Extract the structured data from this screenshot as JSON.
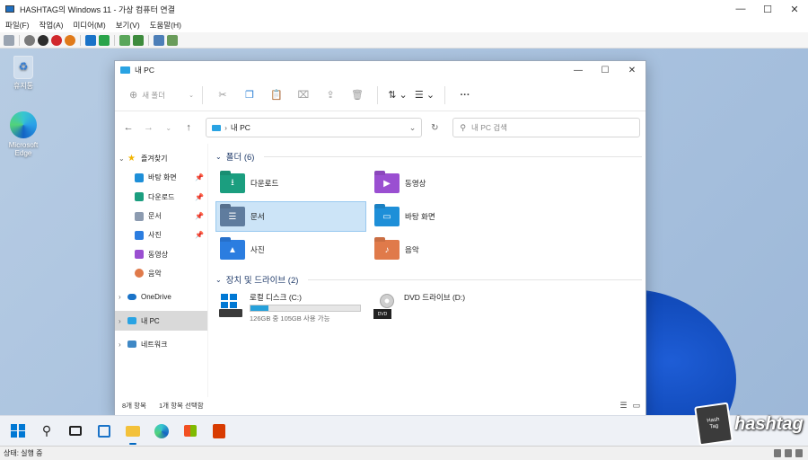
{
  "host": {
    "title": "HASHTAG의 Windows 11 - 가상 컴퓨터 연결",
    "menu": [
      "파일(F)",
      "작업(A)",
      "미디어(M)",
      "보기(V)",
      "도움말(H)"
    ],
    "status": "상태: 실행 중"
  },
  "desktop": {
    "icons": [
      {
        "label": "휴지통",
        "icon": "recycle-bin-icon"
      },
      {
        "label": "Microsoft Edge",
        "icon": "edge-icon"
      }
    ]
  },
  "explorer": {
    "title": "내 PC",
    "toolbar": {
      "new_label": "새 폴더"
    },
    "address": {
      "path": "내 PC"
    },
    "search": {
      "placeholder": "내 PC 검색"
    },
    "sidebar": {
      "quick_access": "즐겨찾기",
      "quick_items": [
        "바탕 화면",
        "다운로드",
        "문서",
        "사진",
        "동영상",
        "음악"
      ],
      "onedrive": "OneDrive",
      "thispc": "내 PC",
      "network": "네트워크"
    },
    "folders_header": "폴더 (6)",
    "folders": [
      {
        "label": "다운로드",
        "color": "#1b9e7f",
        "icon": "download-folder-icon"
      },
      {
        "label": "동영상",
        "color": "#9a4fd1",
        "icon": "video-folder-icon"
      },
      {
        "label": "문서",
        "color": "#5f7c9e",
        "icon": "documents-folder-icon"
      },
      {
        "label": "바탕 화면",
        "color": "#1e8fd8",
        "icon": "desktop-folder-icon"
      },
      {
        "label": "사진",
        "color": "#2b7de0",
        "icon": "pictures-folder-icon"
      },
      {
        "label": "음악",
        "color": "#e07a4a",
        "icon": "music-folder-icon"
      }
    ],
    "drives_header": "장치 및 드라이브 (2)",
    "drives": [
      {
        "label": "로컬 디스크 (C:)",
        "space": "126GB 중 105GB 사용 가능",
        "used_fraction": 0.167
      },
      {
        "label": "DVD 드라이브 (D:)"
      }
    ],
    "status": {
      "count": "8개 항목",
      "selected": "1개 항목 선택함"
    }
  },
  "brand": {
    "cube_text": "Hash\nTag",
    "word": "hashtag"
  },
  "colors": {
    "accent": "#0078d4",
    "selection": "#cce4f7"
  }
}
